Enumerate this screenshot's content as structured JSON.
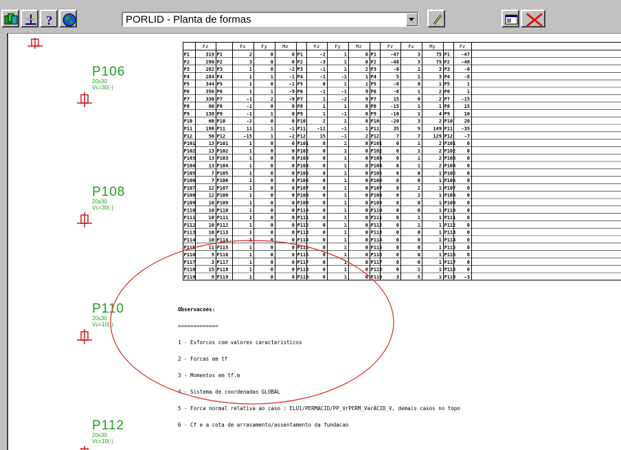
{
  "toolbar": {
    "buttons": [
      {
        "name": "layers-icon"
      },
      {
        "name": "structure-icon"
      },
      {
        "name": "help-icon"
      },
      {
        "name": "globe-icon"
      }
    ],
    "combo_value": "PORLID - Planta de formas",
    "edit_icon": "pencil-icon",
    "view_icon": "window-icon",
    "close_icon": "close-icon"
  },
  "pillars": [
    {
      "label": "P106",
      "dim": "20x30",
      "load": "Vc=30(-)"
    },
    {
      "label": "P108",
      "dim": "20x30",
      "load": "Vc=30(-)"
    },
    {
      "label": "P110",
      "dim": "20x30",
      "load": "Vc=10(-)"
    },
    {
      "label": "P112",
      "dim": "20x30",
      "load": "Vc=10(-)"
    }
  ],
  "table": {
    "headers": [
      "Fz",
      "Fx",
      "Fy",
      "Mz",
      "Fz",
      "Fy",
      "Mz",
      "Fz",
      "Fx",
      "My",
      "Fz"
    ],
    "rows": [
      [
        "P1",
        "319",
        "P1",
        "2",
        "0",
        "0",
        "P1",
        "-2",
        "1",
        "0",
        "P1",
        "-47",
        "3",
        "75",
        "P1",
        "-47"
      ],
      [
        "P2",
        "290",
        "P2",
        "3",
        "0",
        "0",
        "P2",
        "-3",
        "1",
        "0",
        "P2",
        "-48",
        "3",
        "75",
        "P2",
        "-48"
      ],
      [
        "P3",
        "282",
        "P3",
        "1",
        "0",
        "-2",
        "P3",
        "-1",
        "1",
        "2",
        "P3",
        "-6",
        "1",
        "3",
        "P3",
        "-6"
      ],
      [
        "P4",
        "284",
        "P4",
        "1",
        "1",
        "-1",
        "P4",
        "-1",
        "-1",
        "1",
        "P4",
        "5",
        "1",
        "3",
        "P4",
        "-8"
      ],
      [
        "P5",
        "344",
        "P5",
        "1",
        "0",
        "-1",
        "P5",
        "0",
        "1",
        "1",
        "P5",
        "-8",
        "0",
        "1",
        "P5",
        "1"
      ],
      [
        "P6",
        "356",
        "P6",
        "1",
        "1",
        "-9",
        "P6",
        "-1",
        "-1",
        "9",
        "P6",
        "-6",
        "1",
        "2",
        "P6",
        "1"
      ],
      [
        "P7",
        "330",
        "P7",
        "-1",
        "2",
        "-9",
        "P7",
        "1",
        "-2",
        "9",
        "P7",
        "15",
        "0",
        "2",
        "P7",
        "-15"
      ],
      [
        "P8",
        "80",
        "P8",
        "-1",
        "0",
        "0",
        "P8",
        "1",
        "1",
        "0",
        "P8",
        "-15",
        "1",
        "1",
        "P8",
        "15"
      ],
      [
        "P9",
        "138",
        "P9",
        "-1",
        "1",
        "0",
        "P9",
        "1",
        "-1",
        "0",
        "P9",
        "-10",
        "1",
        "4",
        "P9",
        "10"
      ],
      [
        "P10",
        "60",
        "P10",
        "-2",
        "0",
        "0",
        "P10",
        "2",
        "1",
        "0",
        "P10",
        "-20",
        "3",
        "2",
        "P10",
        "20"
      ],
      [
        "P11",
        "190",
        "P11",
        "11",
        "1",
        "-1",
        "P11",
        "-11",
        "-1",
        "1",
        "P11",
        "35",
        "9",
        "149",
        "P11",
        "-35"
      ],
      [
        "P12",
        "50",
        "P12",
        "-15",
        "1",
        "-2",
        "P12",
        "15",
        "-1",
        "2",
        "P12",
        "7",
        "7",
        "129",
        "P12",
        "-7"
      ],
      [
        "P101",
        "13",
        "P101",
        "1",
        "0",
        "0",
        "P101",
        "0",
        "1",
        "0",
        "P101",
        "0",
        "1",
        "2",
        "P101",
        "0"
      ],
      [
        "P102",
        "13",
        "P102",
        "1",
        "0",
        "0",
        "P102",
        "0",
        "1",
        "0",
        "P102",
        "0",
        "1",
        "2",
        "P102",
        "0"
      ],
      [
        "P103",
        "13",
        "P103",
        "1",
        "0",
        "0",
        "P103",
        "0",
        "1",
        "0",
        "P103",
        "0",
        "1",
        "2",
        "P103",
        "0"
      ],
      [
        "P104",
        "13",
        "P104",
        "1",
        "0",
        "0",
        "P104",
        "0",
        "1",
        "0",
        "P104",
        "0",
        "1",
        "2",
        "P104",
        "0"
      ],
      [
        "P105",
        "7",
        "P105",
        "1",
        "0",
        "0",
        "P105",
        "0",
        "1",
        "0",
        "P105",
        "0",
        "0",
        "1",
        "P105",
        "0"
      ],
      [
        "P106",
        "7",
        "P106",
        "1",
        "0",
        "0",
        "P106",
        "0",
        "1",
        "0",
        "P106",
        "0",
        "0",
        "1",
        "P106",
        "0"
      ],
      [
        "P107",
        "12",
        "P107",
        "1",
        "0",
        "0",
        "P107",
        "0",
        "1",
        "0",
        "P107",
        "0",
        "2",
        "1",
        "P107",
        "0"
      ],
      [
        "P108",
        "12",
        "P108",
        "1",
        "0",
        "0",
        "P108",
        "0",
        "1",
        "0",
        "P108",
        "0",
        "2",
        "1",
        "P108",
        "0"
      ],
      [
        "P109",
        "10",
        "P109",
        "1",
        "0",
        "0",
        "P109",
        "0",
        "1",
        "0",
        "P109",
        "0",
        "0",
        "1",
        "P109",
        "0"
      ],
      [
        "P110",
        "10",
        "P110",
        "1",
        "0",
        "0",
        "P110",
        "0",
        "1",
        "0",
        "P110",
        "0",
        "0",
        "1",
        "P110",
        "0"
      ],
      [
        "P111",
        "10",
        "P111",
        "1",
        "0",
        "0",
        "P111",
        "0",
        "1",
        "0",
        "P111",
        "0",
        "1",
        "1",
        "P111",
        "0"
      ],
      [
        "P112",
        "10",
        "P112",
        "1",
        "0",
        "0",
        "P112",
        "0",
        "1",
        "0",
        "P112",
        "0",
        "1",
        "1",
        "P112",
        "0"
      ],
      [
        "P113",
        "10",
        "P113",
        "1",
        "0",
        "0",
        "P113",
        "0",
        "1",
        "0",
        "P113",
        "0",
        "0",
        "1",
        "P113",
        "0"
      ],
      [
        "P114",
        "10",
        "P114",
        "1",
        "0",
        "0",
        "P114",
        "0",
        "1",
        "0",
        "P114",
        "0",
        "0",
        "1",
        "P114",
        "0"
      ],
      [
        "P115",
        "11",
        "P115",
        "1",
        "0",
        "0",
        "P115",
        "0",
        "1",
        "0",
        "P115",
        "0",
        "0",
        "1",
        "P115",
        "0"
      ],
      [
        "P116",
        "9",
        "P116",
        "1",
        "0",
        "0",
        "P116",
        "0",
        "1",
        "0",
        "P116",
        "0",
        "0",
        "1",
        "P116",
        "0"
      ],
      [
        "P117",
        "3",
        "P117",
        "1",
        "0",
        "0",
        "P117",
        "0",
        "1",
        "0",
        "P117",
        "0",
        "0",
        "1",
        "P117",
        "0"
      ],
      [
        "P118",
        "15",
        "P118",
        "1",
        "0",
        "0",
        "P118",
        "0",
        "1",
        "0",
        "P118",
        "0",
        "1",
        "1",
        "P118",
        "0"
      ],
      [
        "P119",
        "9",
        "P119",
        "1",
        "0",
        "0",
        "P119",
        "0",
        "1",
        "0",
        "P119",
        "3",
        "5",
        "1",
        "P119",
        "-3"
      ]
    ]
  },
  "observations": {
    "title": "Observacoes:",
    "underline": "=============",
    "lines": [
      "1 - Esforcos com valores caracteristicos",
      "2 - Forcas em tf",
      "3 - Momentos em tf.m",
      "4 - Sistema de coordenadas GLOBAL",
      "5 - Forca normal relativa ao caso : ELU1/PERMACID/PP_VrPERM_VarACID_V, demais casos no topo",
      "6 - Cf e a cota de arrasamento/assentamento da fundacao"
    ]
  },
  "colors": {
    "pillar": "#1aa11a",
    "annotation": "#e02020",
    "toolbar": "#c0c0c0"
  }
}
